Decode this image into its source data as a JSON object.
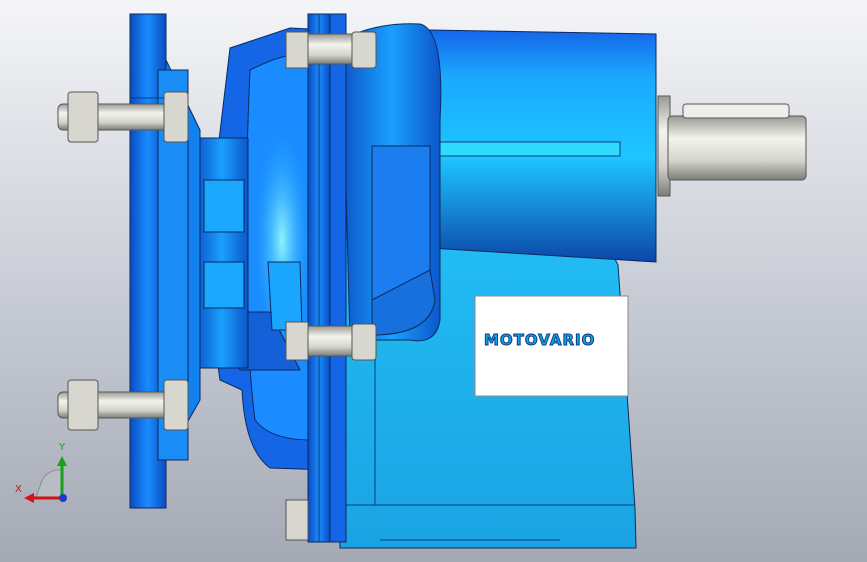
{
  "scene": {
    "subject": "gear-reducer-3d-model",
    "nameplate": {
      "brand": "MOTOVARIO"
    },
    "axis_triad": {
      "x_label": "X",
      "y_label": "Y"
    },
    "colors": {
      "background_top": "#f4f5f8",
      "background_bottom": "#a4a9b4",
      "housing_blue": "#1e6ee8",
      "housing_light": "#1ec6ff",
      "shaft_steel": "#d8d8d2",
      "nameplate_white": "#ffffff",
      "brand_text": "#0aa8e0"
    }
  }
}
